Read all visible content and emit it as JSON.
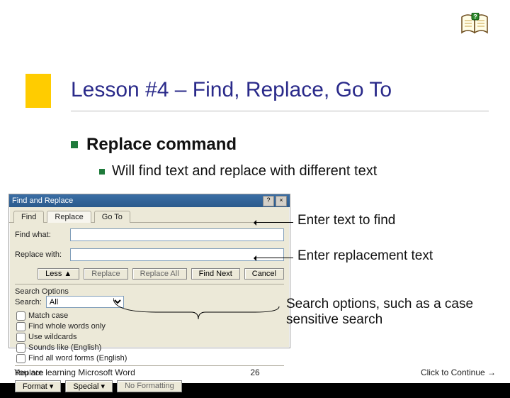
{
  "slide": {
    "title": "Lesson #4 – Find, Replace, Go To",
    "bullet1": "Replace command",
    "bullet2": "Will find text and replace with different text"
  },
  "dialog": {
    "title": "Find and Replace",
    "help_btn": "?",
    "close_btn": "×",
    "tabs": {
      "find": "Find",
      "replace": "Replace",
      "goto": "Go To"
    },
    "find_label": "Find what:",
    "find_value": "",
    "replace_label": "Replace with:",
    "replace_value": "",
    "buttons": {
      "less": "Less ▲",
      "replace": "Replace",
      "replace_all": "Replace All",
      "find_next": "Find Next",
      "cancel": "Cancel",
      "format": "Format ▾",
      "special": "Special ▾",
      "no_formatting": "No Formatting"
    },
    "search_options_title": "Search Options",
    "search_label": "Search:",
    "search_value": "All",
    "checks": {
      "match_case": "Match case",
      "whole_words": "Find whole words only",
      "wildcards": "Use wildcards",
      "sounds_like": "Sounds like (English)",
      "word_forms": "Find all word forms (English)"
    },
    "replace_section": "Replace"
  },
  "callouts": {
    "c1": "Enter text to find",
    "c2": "Enter replacement text",
    "c3": "Search options, such as a case sensitive search"
  },
  "footer": {
    "left": "You are learning Microsoft Word",
    "center": "26",
    "right": "Click to Continue →"
  }
}
